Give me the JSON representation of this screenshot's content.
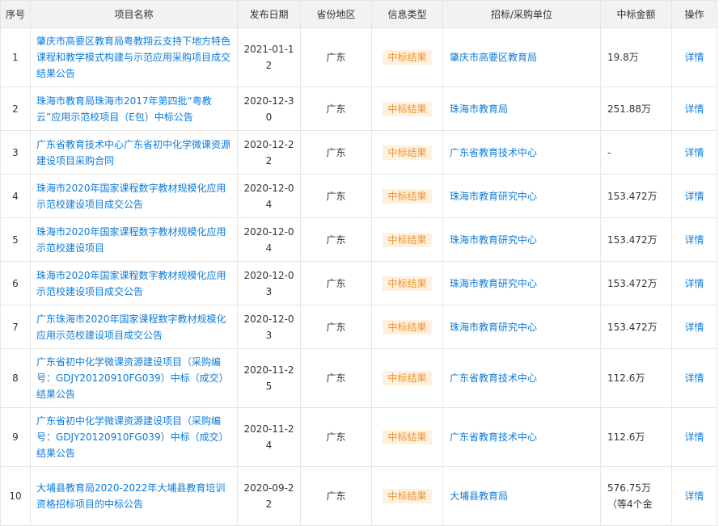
{
  "table": {
    "headers": [
      "序号",
      "项目名称",
      "发布日期",
      "省份地区",
      "信息类型",
      "招标/采购单位",
      "中标金额",
      "操作"
    ],
    "rows": [
      {
        "no": "1",
        "title": "肇庆市高要区教育局粤教翔云支持下地方特色课程和教学模式构建与示范应用采购项目成交结果公告",
        "date": "2021-01-12",
        "region": "广东",
        "type": "中标结果",
        "org": "肇庆市高要区教育局",
        "amount": "19.8万",
        "op": "详情"
      },
      {
        "no": "2",
        "title": "珠海市教育局珠海市2017年第四批“粤教云”应用示范校项目（E包）中标公告",
        "date": "2020-12-30",
        "region": "广东",
        "type": "中标结果",
        "org": "珠海市教育局",
        "amount": "251.88万",
        "op": "详情"
      },
      {
        "no": "3",
        "title": "广东省教育技术中心广东省初中化学微课资源建设项目采购合同",
        "date": "2020-12-22",
        "region": "广东",
        "type": "中标结果",
        "org": "广东省教育技术中心",
        "amount": "-",
        "op": "详情"
      },
      {
        "no": "4",
        "title": "珠海市2020年国家课程数字教材规模化应用示范校建设项目成交公告",
        "date": "2020-12-04",
        "region": "广东",
        "type": "中标结果",
        "org": "珠海市教育研究中心",
        "amount": "153.472万",
        "op": "详情"
      },
      {
        "no": "5",
        "title": "珠海市2020年国家课程数字教材规模化应用示范校建设项目",
        "date": "2020-12-04",
        "region": "广东",
        "type": "中标结果",
        "org": "珠海市教育研究中心",
        "amount": "153.472万",
        "op": "详情"
      },
      {
        "no": "6",
        "title": "珠海市2020年国家课程数字教材规模化应用示范校建设项目成交公告",
        "date": "2020-12-03",
        "region": "广东",
        "type": "中标结果",
        "org": "珠海市教育研究中心",
        "amount": "153.472万",
        "op": "详情"
      },
      {
        "no": "7",
        "title": "广东珠海市2020年国家课程数字教材规模化应用示范校建设项目成交公告",
        "date": "2020-12-03",
        "region": "广东",
        "type": "中标结果",
        "org": "珠海市教育研究中心",
        "amount": "153.472万",
        "op": "详情"
      },
      {
        "no": "8",
        "title": "广东省初中化学微课资源建设项目（采购编号：GDJY20120910FG039）中标（成交）结果公告",
        "date": "2020-11-25",
        "region": "广东",
        "type": "中标结果",
        "org": "广东省教育技术中心",
        "amount": "112.6万",
        "op": "详情"
      },
      {
        "no": "9",
        "title": "广东省初中化学微课资源建设项目（采购编号：GDJY20120910FG039）中标（成交）结果公告",
        "date": "2020-11-24",
        "region": "广东",
        "type": "中标结果",
        "org": "广东省教育技术中心",
        "amount": "112.6万",
        "op": "详情"
      },
      {
        "no": "10",
        "title": "大埔县教育局2020-2022年大埔县教育培训资格招标项目的中标公告",
        "date": "2020-09-22",
        "region": "广东",
        "type": "中标结果",
        "org": "大埔县教育局",
        "amount": "576.75万（等4个金",
        "op": "详情"
      }
    ]
  },
  "colors": {
    "link": "#0d7bd8",
    "badge_bg": "#fff1df",
    "badge_text": "#f0932b",
    "header_bg": "#f2f2f2",
    "border": "#e6e6e6"
  }
}
